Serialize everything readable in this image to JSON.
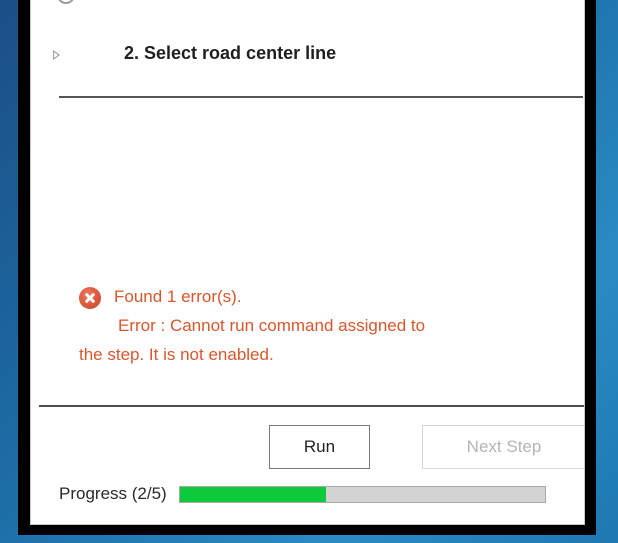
{
  "step": {
    "title": "2.  Select road center line"
  },
  "message": {
    "summary": "Found 1 error(s).",
    "detail_line1": "Error : Cannot run command assigned to",
    "detail_line2": "the step.  It is not enabled."
  },
  "buttons": {
    "run_label": "Run",
    "next_label": "Next Step"
  },
  "progress": {
    "label": "Progress (2/5)",
    "fraction": 0.4,
    "fill_color": "#0ec93a"
  },
  "colors": {
    "error_text": "#d9572c",
    "error_icon": "#d9573d",
    "disabled_text": "#b5b5b5"
  },
  "icons": {
    "expand": "triangle-right-outline",
    "error": "error-circle-x"
  }
}
